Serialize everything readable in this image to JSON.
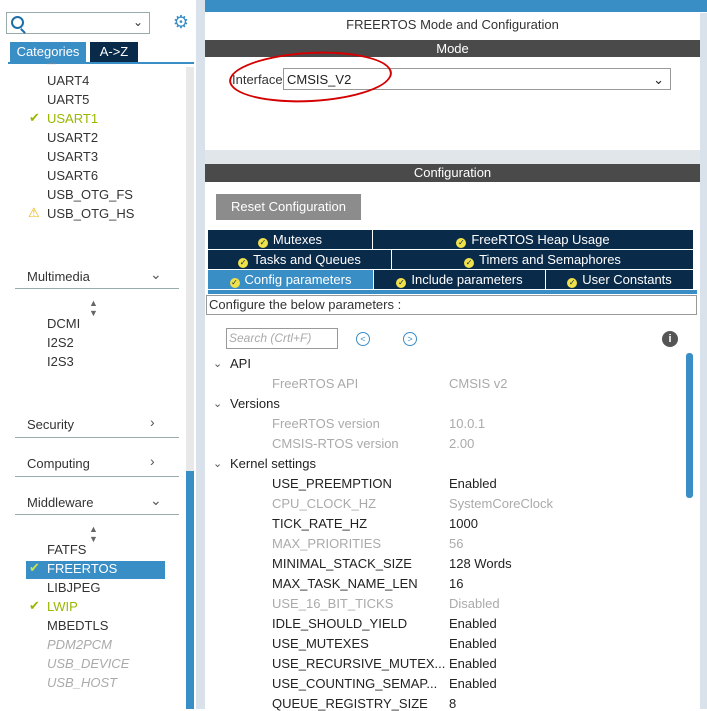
{
  "left_panel": {
    "search_placeholder": "",
    "tabs": {
      "categories": "Categories",
      "az": "A->Z"
    },
    "connectivity_items": [
      {
        "label": "UART4",
        "state": "normal"
      },
      {
        "label": "UART5",
        "state": "normal"
      },
      {
        "label": "USART1",
        "state": "enabled"
      },
      {
        "label": "USART2",
        "state": "normal"
      },
      {
        "label": "USART3",
        "state": "normal"
      },
      {
        "label": "USART6",
        "state": "normal"
      },
      {
        "label": "USB_OTG_FS",
        "state": "normal"
      },
      {
        "label": "USB_OTG_HS",
        "state": "warning"
      }
    ],
    "multimedia": {
      "label": "Multimedia",
      "items": [
        "DCMI",
        "I2S2",
        "I2S3"
      ]
    },
    "security": {
      "label": "Security"
    },
    "computing": {
      "label": "Computing"
    },
    "middleware": {
      "label": "Middleware",
      "items": [
        {
          "label": "FATFS",
          "state": "normal"
        },
        {
          "label": "FREERTOS",
          "state": "selected"
        },
        {
          "label": "LIBJPEG",
          "state": "normal"
        },
        {
          "label": "LWIP",
          "state": "enabled"
        },
        {
          "label": "MBEDTLS",
          "state": "normal"
        },
        {
          "label": "PDM2PCM",
          "state": "disabled"
        },
        {
          "label": "USB_DEVICE",
          "state": "disabled"
        },
        {
          "label": "USB_HOST",
          "state": "disabled"
        }
      ]
    }
  },
  "right_panel": {
    "title": "FREERTOS Mode and Configuration",
    "mode_header": "Mode",
    "interface_label": "Interface",
    "interface_value": "CMSIS_V2",
    "config_header": "Configuration",
    "reset_button": "Reset Configuration",
    "tabs_row1": [
      "Mutexes",
      "FreeRTOS Heap Usage"
    ],
    "tabs_row2": [
      "Tasks and Queues",
      "Timers and Semaphores"
    ],
    "tabs_row3": [
      "Config parameters",
      "Include parameters",
      "User Constants"
    ],
    "active_tab": "Config parameters",
    "configure_note": "Configure the below parameters :",
    "search_placeholder": "Search (Crtl+F)",
    "groups": [
      {
        "name": "API",
        "params": [
          {
            "name": "FreeRTOS API",
            "value": "CMSIS v2",
            "disabled": true
          }
        ]
      },
      {
        "name": "Versions",
        "params": [
          {
            "name": "FreeRTOS version",
            "value": "10.0.1",
            "disabled": true
          },
          {
            "name": "CMSIS-RTOS version",
            "value": "2.00",
            "disabled": true
          }
        ]
      },
      {
        "name": "Kernel settings",
        "params": [
          {
            "name": "USE_PREEMPTION",
            "value": "Enabled",
            "disabled": false
          },
          {
            "name": "CPU_CLOCK_HZ",
            "value": "SystemCoreClock",
            "disabled": true
          },
          {
            "name": "TICK_RATE_HZ",
            "value": "1000",
            "disabled": false
          },
          {
            "name": "MAX_PRIORITIES",
            "value": "56",
            "disabled": true
          },
          {
            "name": "MINIMAL_STACK_SIZE",
            "value": "128 Words",
            "disabled": false
          },
          {
            "name": "MAX_TASK_NAME_LEN",
            "value": "16",
            "disabled": false
          },
          {
            "name": "USE_16_BIT_TICKS",
            "value": "Disabled",
            "disabled": true
          },
          {
            "name": "IDLE_SHOULD_YIELD",
            "value": "Enabled",
            "disabled": false
          },
          {
            "name": "USE_MUTEXES",
            "value": "Enabled",
            "disabled": false
          },
          {
            "name": "USE_RECURSIVE_MUTEX...",
            "value": "Enabled",
            "disabled": false
          },
          {
            "name": "USE_COUNTING_SEMAP...",
            "value": "Enabled",
            "disabled": false
          },
          {
            "name": "QUEUE_REGISTRY_SIZE",
            "value": "8",
            "disabled": false
          }
        ]
      }
    ]
  },
  "colors": {
    "accent": "#3a8ec6",
    "navy": "#0a2a4a",
    "header_grey": "#4a4a4a",
    "enabled_green": "#9ab800",
    "warning_yellow": "#e8b400",
    "annotation_red": "#d40000"
  }
}
